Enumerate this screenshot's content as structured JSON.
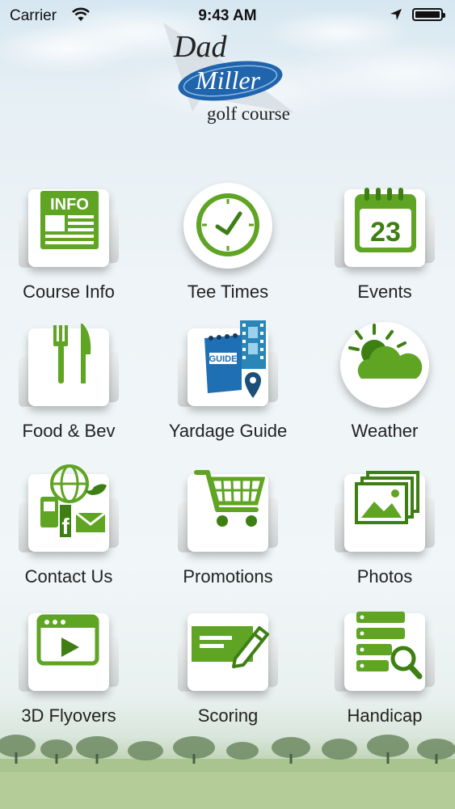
{
  "status_bar": {
    "carrier": "Carrier",
    "time": "9:43 AM"
  },
  "logo": {
    "line1": "Dad",
    "line2": "Miller",
    "line3": "golf course"
  },
  "menu": [
    {
      "label": "Course Info",
      "icon": "info-newspaper-icon"
    },
    {
      "label": "Tee Times",
      "icon": "clock-icon"
    },
    {
      "label": "Events",
      "icon": "calendar-icon",
      "badge": "23"
    },
    {
      "label": "Food & Bev",
      "icon": "fork-knife-icon"
    },
    {
      "label": "Yardage Guide",
      "icon": "guide-map-icon",
      "badge": "GUIDE"
    },
    {
      "label": "Weather",
      "icon": "sun-cloud-icon"
    },
    {
      "label": "Contact Us",
      "icon": "social-contact-icon"
    },
    {
      "label": "Promotions",
      "icon": "shopping-cart-icon"
    },
    {
      "label": "Photos",
      "icon": "photos-icon"
    },
    {
      "label": "3D Flyovers",
      "icon": "video-player-icon"
    },
    {
      "label": "Scoring",
      "icon": "scorecard-pencil-icon"
    },
    {
      "label": "Handicap",
      "icon": "database-search-icon"
    }
  ],
  "info_icon_text": "INFO",
  "colors": {
    "green": "#5fa423",
    "dark_green": "#3e7f14",
    "blue": "#1f6fb5",
    "background": "#eef4f7"
  }
}
